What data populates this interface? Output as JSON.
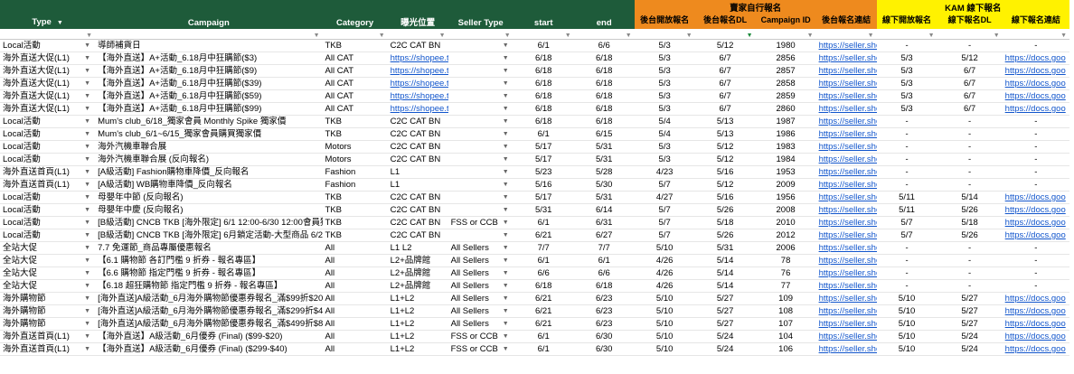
{
  "headers": {
    "type": "Type",
    "campaign": "Campaign",
    "category": "Category",
    "exposure": "曝光位置",
    "seller_type": "Seller Type",
    "start": "start",
    "end": "end",
    "seller_group": "賣家自行報名",
    "seller_start": "後台開放報名",
    "seller_dl": "後台報名DL",
    "campaign_id": "Campaign ID",
    "seller_link": "後台報名連結",
    "kam_group": "KAM 線下報名",
    "kam_start": "線下開放報名",
    "kam_dl": "線下報名DL",
    "kam_link": "線下報名連結"
  },
  "rows": [
    {
      "type": "Local活動",
      "campaign": "導師補貨日",
      "category": "TKB",
      "exposure": "C2C CAT BN",
      "seller_type": "",
      "start": "6/1",
      "end": "6/6",
      "s_start": "5/3",
      "s_dl": "5/12",
      "cid": "1980",
      "s_link": "https://seller.sho",
      "k_start": "-",
      "k_dl": "-",
      "k_link": "-"
    },
    {
      "type": "海外直送大促(L1)",
      "campaign": "【海外直送】A+活動_6.18月中狂購節($3)",
      "category": "All CAT",
      "exposure": "https://shopee.t",
      "seller_type": "",
      "start": "6/18",
      "end": "6/18",
      "s_start": "5/3",
      "s_dl": "6/7",
      "cid": "2856",
      "s_link": "https://seller.sho",
      "k_start": "5/3",
      "k_dl": "5/12",
      "k_link": "https://docs.goo"
    },
    {
      "type": "海外直送大促(L1)",
      "campaign": "【海外直送】A+活動_6.18月中狂購節($9)",
      "category": "All CAT",
      "exposure": "https://shopee.t",
      "seller_type": "",
      "start": "6/18",
      "end": "6/18",
      "s_start": "5/3",
      "s_dl": "6/7",
      "cid": "2857",
      "s_link": "https://seller.sho",
      "k_start": "5/3",
      "k_dl": "6/7",
      "k_link": "https://docs.goo"
    },
    {
      "type": "海外直送大促(L1)",
      "campaign": "【海外直送】A+活動_6.18月中狂購節($39)",
      "category": "All CAT",
      "exposure": "https://shopee.t",
      "seller_type": "",
      "start": "6/18",
      "end": "6/18",
      "s_start": "5/3",
      "s_dl": "6/7",
      "cid": "2858",
      "s_link": "https://seller.sho",
      "k_start": "5/3",
      "k_dl": "6/7",
      "k_link": "https://docs.goo"
    },
    {
      "type": "海外直送大促(L1)",
      "campaign": "【海外直送】A+活動_6.18月中狂購節($59)",
      "category": "All CAT",
      "exposure": "https://shopee.t",
      "seller_type": "",
      "start": "6/18",
      "end": "6/18",
      "s_start": "5/3",
      "s_dl": "6/7",
      "cid": "2859",
      "s_link": "https://seller.sho",
      "k_start": "5/3",
      "k_dl": "6/7",
      "k_link": "https://docs.goo"
    },
    {
      "type": "海外直送大促(L1)",
      "campaign": "【海外直送】A+活動_6.18月中狂購節($99)",
      "category": "All CAT",
      "exposure": "https://shopee.t",
      "seller_type": "",
      "start": "6/18",
      "end": "6/18",
      "s_start": "5/3",
      "s_dl": "6/7",
      "cid": "2860",
      "s_link": "https://seller.sho",
      "k_start": "5/3",
      "k_dl": "6/7",
      "k_link": "https://docs.goo"
    },
    {
      "type": "Local活動",
      "campaign": "Mum's club_6/18_獨家會員 Monthly Spike 獨家價",
      "category": "TKB",
      "exposure": "C2C CAT BN",
      "seller_type": "",
      "start": "6/18",
      "end": "6/18",
      "s_start": "5/4",
      "s_dl": "5/13",
      "cid": "1987",
      "s_link": "https://seller.sho",
      "k_start": "-",
      "k_dl": "-",
      "k_link": "-"
    },
    {
      "type": "Local活動",
      "campaign": "Mum's club_6/1~6/15_獨家會員購買獨家價",
      "category": "TKB",
      "exposure": "C2C CAT BN",
      "seller_type": "",
      "start": "6/1",
      "end": "6/15",
      "s_start": "5/4",
      "s_dl": "5/13",
      "cid": "1986",
      "s_link": "https://seller.sho",
      "k_start": "-",
      "k_dl": "-",
      "k_link": "-"
    },
    {
      "type": "Local活動",
      "campaign": "海外汽機車聯合展",
      "category": "Motors",
      "exposure": "C2C CAT BN",
      "seller_type": "",
      "start": "5/17",
      "end": "5/31",
      "s_start": "5/3",
      "s_dl": "5/12",
      "cid": "1983",
      "s_link": "https://seller.sho",
      "k_start": "-",
      "k_dl": "-",
      "k_link": "-"
    },
    {
      "type": "Local活動",
      "campaign": "海外汽機車聯合展 (反向報名)",
      "category": "Motors",
      "exposure": "C2C CAT BN",
      "seller_type": "",
      "start": "5/17",
      "end": "5/31",
      "s_start": "5/3",
      "s_dl": "5/12",
      "cid": "1984",
      "s_link": "https://seller.sho",
      "k_start": "-",
      "k_dl": "-",
      "k_link": "-"
    },
    {
      "type": "海外直送首頁(L1)",
      "campaign": "[A級活動] Fashion購物車降價_反向報名",
      "category": "Fashion",
      "exposure": "L1",
      "seller_type": "",
      "start": "5/23",
      "end": "5/28",
      "s_start": "4/23",
      "s_dl": "5/16",
      "cid": "1953",
      "s_link": "https://seller.sho",
      "k_start": "-",
      "k_dl": "-",
      "k_link": "-"
    },
    {
      "type": "海外直送首頁(L1)",
      "campaign": "[A級活動] WB購物車降價_反向報名",
      "category": "Fashion",
      "exposure": "L1",
      "seller_type": "",
      "start": "5/16",
      "end": "5/30",
      "s_start": "5/7",
      "s_dl": "5/12",
      "cid": "2009",
      "s_link": "https://seller.sho",
      "k_start": "-",
      "k_dl": "-",
      "k_link": "-"
    },
    {
      "type": "Local活動",
      "campaign": "母嬰年中節 (反向報名)",
      "category": "TKB",
      "exposure": "C2C CAT BN",
      "seller_type": "",
      "start": "5/17",
      "end": "5/31",
      "s_start": "4/27",
      "s_dl": "5/16",
      "cid": "1956",
      "s_link": "https://seller.sho",
      "k_start": "5/11",
      "k_dl": "5/14",
      "k_link": "https://docs.goo"
    },
    {
      "type": "Local活動",
      "campaign": "母嬰年中慶 (反向報名)",
      "category": "TKB",
      "exposure": "C2C CAT BN",
      "seller_type": "",
      "start": "5/31",
      "end": "6/14",
      "s_start": "5/7",
      "s_dl": "5/26",
      "cid": "2008",
      "s_link": "https://seller.sho",
      "k_start": "5/11",
      "k_dl": "5/26",
      "k_link": "https://docs.goo"
    },
    {
      "type": "Local活動",
      "campaign": "[B級活動] CNCB TKB [海外限定] 6/1 12:00-6/30 12:00會員獨",
      "category": "TKB",
      "exposure": "C2C CAT BN",
      "seller_type": "FSS or CCB",
      "start": "6/1",
      "end": "6/31",
      "s_start": "5/7",
      "s_dl": "5/18",
      "cid": "2010",
      "s_link": "https://seller.sho",
      "k_start": "5/7",
      "k_dl": "5/18",
      "k_link": "https://docs.goo"
    },
    {
      "type": "Local活動",
      "campaign": "[B級活動] CNCB TKB [海外限定] 6月鎖定活動-大型商品 6/21-6",
      "category": "TKB",
      "exposure": "C2C CAT BN",
      "seller_type": "",
      "start": "6/21",
      "end": "6/27",
      "s_start": "5/7",
      "s_dl": "5/26",
      "cid": "2012",
      "s_link": "https://seller.sho",
      "k_start": "5/7",
      "k_dl": "5/26",
      "k_link": "https://docs.goo"
    },
    {
      "type": "全站大促",
      "campaign": "7.7 免運節_商品專屬優惠報名",
      "category": "All",
      "exposure": "L1 L2",
      "seller_type": "All Sellers",
      "start": "7/7",
      "end": "7/7",
      "s_start": "5/10",
      "s_dl": "5/31",
      "cid": "2006",
      "s_link": "https://seller.sho",
      "k_start": "-",
      "k_dl": "-",
      "k_link": "-"
    },
    {
      "type": "全站大促",
      "campaign": "【6.1 購物節 各訂門檻 9 折券 - 報名專區】",
      "category": "All",
      "exposure": "L2+品牌館",
      "seller_type": "All Sellers",
      "start": "6/1",
      "end": "6/1",
      "s_start": "4/26",
      "s_dl": "5/14",
      "cid": "78",
      "s_link": "https://seller.sho",
      "k_start": "-",
      "k_dl": "-",
      "k_link": "-"
    },
    {
      "type": "全站大促",
      "campaign": "【6.6 購物節 指定門檻 9 折券 - 報名專區】",
      "category": "All",
      "exposure": "L2+品牌館",
      "seller_type": "All Sellers",
      "start": "6/6",
      "end": "6/6",
      "s_start": "4/26",
      "s_dl": "5/14",
      "cid": "76",
      "s_link": "https://seller.sho",
      "k_start": "-",
      "k_dl": "-",
      "k_link": "-"
    },
    {
      "type": "全站大促",
      "campaign": "【6.18 超狂購物節 指定門檻 9 折券 - 報名專區】",
      "category": "All",
      "exposure": "L2+品牌館",
      "seller_type": "All Sellers",
      "start": "6/18",
      "end": "6/18",
      "s_start": "4/26",
      "s_dl": "5/14",
      "cid": "77",
      "s_link": "https://seller.sho",
      "k_start": "-",
      "k_dl": "-",
      "k_link": "-"
    },
    {
      "type": "海外購物節",
      "campaign": "[海外直送]A級活動_6月海外購物節優惠券報名_滿$99折$20",
      "category": "All",
      "exposure": "L1+L2",
      "seller_type": "All Sellers",
      "start": "6/21",
      "end": "6/23",
      "s_start": "5/10",
      "s_dl": "5/27",
      "cid": "109",
      "s_link": "https://seller.sho",
      "k_start": "5/10",
      "k_dl": "5/27",
      "k_link": "https://docs.goo"
    },
    {
      "type": "海外購物節",
      "campaign": "[海外直送]A級活動_6月海外購物節優惠券報名_滿$299折$40",
      "category": "All",
      "exposure": "L1+L2",
      "seller_type": "All Sellers",
      "start": "6/21",
      "end": "6/23",
      "s_start": "5/10",
      "s_dl": "5/27",
      "cid": "108",
      "s_link": "https://seller.sho",
      "k_start": "5/10",
      "k_dl": "5/27",
      "k_link": "https://docs.goo"
    },
    {
      "type": "海外購物節",
      "campaign": "[海外直送]A級活動_6月海外購物節優惠券報名_滿$499折$80",
      "category": "All",
      "exposure": "L1+L2",
      "seller_type": "All Sellers",
      "start": "6/21",
      "end": "6/23",
      "s_start": "5/10",
      "s_dl": "5/27",
      "cid": "107",
      "s_link": "https://seller.sho",
      "k_start": "5/10",
      "k_dl": "5/27",
      "k_link": "https://docs.goo"
    },
    {
      "type": "海外直送首頁(L1)",
      "campaign": "【海外直送】A級活動_6月優券 (Final) ($99-$20)",
      "category": "All",
      "exposure": "L1+L2",
      "seller_type": "FSS or CCB",
      "start": "6/1",
      "end": "6/30",
      "s_start": "5/10",
      "s_dl": "5/24",
      "cid": "104",
      "s_link": "https://seller.sho",
      "k_start": "5/10",
      "k_dl": "5/24",
      "k_link": "https://docs.goo"
    },
    {
      "type": "海外直送首頁(L1)",
      "campaign": "【海外直送】A級活動_6月優券 (Final) ($299-$40)",
      "category": "All",
      "exposure": "L1+L2",
      "seller_type": "FSS or CCB",
      "start": "6/1",
      "end": "6/30",
      "s_start": "5/10",
      "s_dl": "5/24",
      "cid": "106",
      "s_link": "https://seller.sho",
      "k_start": "5/10",
      "k_dl": "5/24",
      "k_link": "https://docs.goo"
    }
  ],
  "colors": {
    "header_dark": "#1e5b3a",
    "header_orange": "#ee8a1e",
    "header_yellow": "#fff200",
    "link": "#1155cc"
  }
}
